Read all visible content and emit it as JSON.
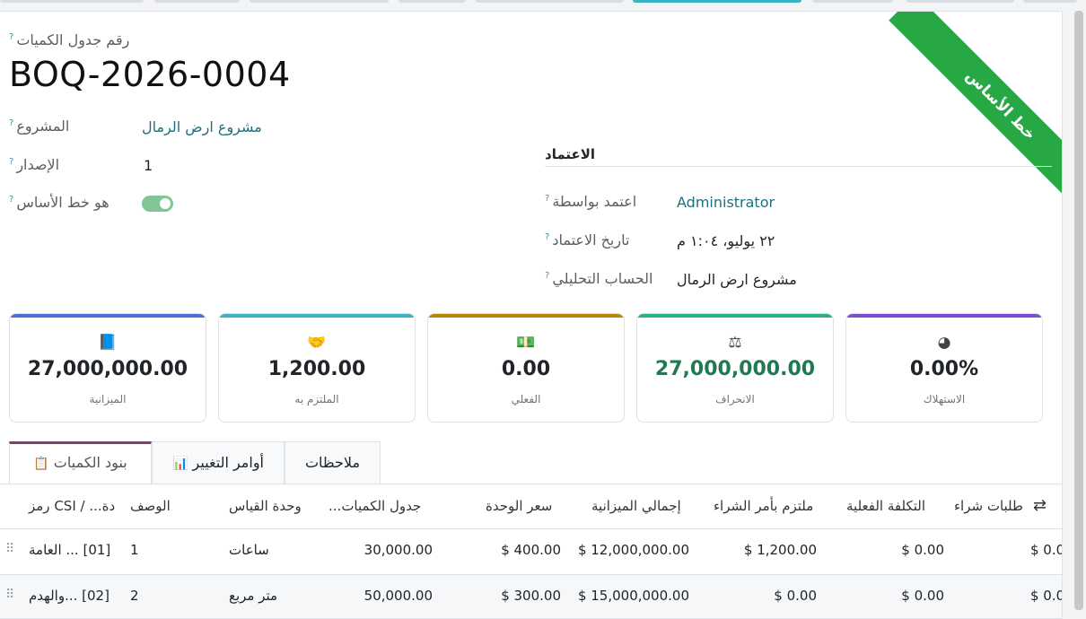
{
  "record": {
    "ref_label": "رقم جدول الكميات",
    "ref_value": "BOQ-2026-0004",
    "ribbon": "خط الأساس"
  },
  "fields": {
    "project_label": "المشروع",
    "project_value": "مشروع ارض الرمال",
    "version_label": "الإصدار",
    "version_value": "1",
    "baseline_label": "هو خط الأساس",
    "baseline_on": true
  },
  "approval": {
    "section_title": "الاعتماد",
    "approved_by_label": "اعتمد بواسطة",
    "approved_by_value": "Administrator",
    "approval_date_label": "تاريخ الاعتماد",
    "approval_date_value": "٢٢ يوليو، ١:٠٤ م",
    "analytic_label": "الحساب التحليلي",
    "analytic_value": "مشروع ارض الرمال"
  },
  "help_mark": "?",
  "cards": [
    {
      "icon": "book-icon",
      "glyph": "📘",
      "value": "27,000,000.00",
      "caption": "الميزانية",
      "color": "#4a6fd8",
      "value_color": "#212529"
    },
    {
      "icon": "handshake-icon",
      "glyph": "🤝",
      "value": "1,200.00",
      "caption": "الملتزم به",
      "color": "#3bb4c1",
      "value_color": "#212529"
    },
    {
      "icon": "money-icon",
      "glyph": "💵",
      "value": "0.00",
      "caption": "الفعلي",
      "color": "#b8860b",
      "value_color": "#212529"
    },
    {
      "icon": "scale-icon",
      "glyph": "⚖",
      "value": "27,000,000.00",
      "caption": "الانحراف",
      "color": "#2bb07f",
      "value_color": "#1e7a53"
    },
    {
      "icon": "pie-chart-icon",
      "glyph": "◕",
      "value": "0.00%",
      "caption": "الاستهلاك",
      "color": "#7a4fd6",
      "value_color": "#212529"
    }
  ],
  "tabs": [
    {
      "label": "بنود الكميات",
      "icon": "clipboard-icon",
      "glyph": "📋",
      "active": true
    },
    {
      "label": "أوامر التغيير",
      "icon": "bar-chart-icon",
      "glyph": "📊",
      "active": false
    },
    {
      "label": "ملاحظات",
      "icon": "",
      "glyph": "",
      "active": false
    }
  ],
  "table": {
    "settings_glyph": "⇄",
    "columns": [
      "رمز CSI / ...دة",
      "الوصف",
      "وحدة القياس",
      "...جدول الكميات",
      "سعر الوحدة",
      "إجمالي الميزانية",
      "ملتزم بأمر الشراء",
      "التكلفة الفعلية",
      "طلبات شراء"
    ],
    "rows": [
      [
        "[01] ... العامة",
        "1",
        "ساعات",
        "30,000.00",
        "$ 400.00",
        "$ 12,000,000.00",
        "$ 1,200.00",
        "$ 0.00",
        "$ 0.0"
      ],
      [
        "[02] ...والهدم",
        "2",
        "متر مربع",
        "50,000.00",
        "$ 300.00",
        "$ 15,000,000.00",
        "$ 0.00",
        "$ 0.00",
        "$ 0.0"
      ]
    ]
  }
}
